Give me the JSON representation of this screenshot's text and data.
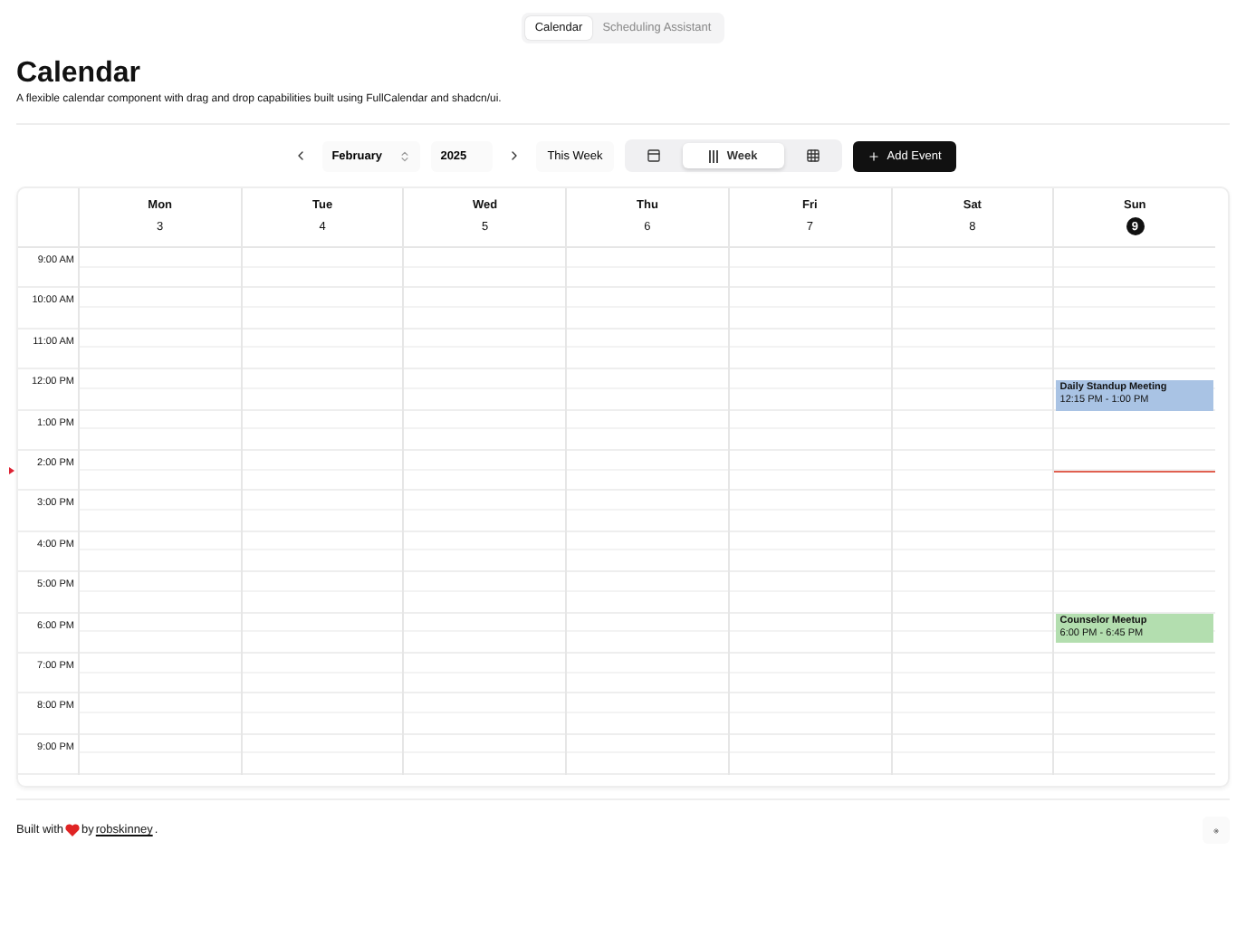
{
  "top_tabs": [
    {
      "label": "Calendar",
      "selected": true
    },
    {
      "label": "Scheduling Assistant",
      "selected": false
    }
  ],
  "title": "Calendar",
  "description": "A flexible calendar component with drag and drop capabilities built using FullCalendar and shadcn/ui.",
  "toolbar": {
    "month": "February",
    "year": "2025",
    "today_button": "This Week",
    "add_button": "Add Event",
    "views": [
      {
        "kind": "day",
        "selected": false
      },
      {
        "kind": "week",
        "label": "Week",
        "selected": true
      },
      {
        "kind": "month",
        "selected": false
      }
    ]
  },
  "days": [
    {
      "name": "Mon",
      "date": "3",
      "today": false
    },
    {
      "name": "Tue",
      "date": "4",
      "today": false
    },
    {
      "name": "Wed",
      "date": "5",
      "today": false
    },
    {
      "name": "Thu",
      "date": "6",
      "today": false
    },
    {
      "name": "Fri",
      "date": "7",
      "today": false
    },
    {
      "name": "Sat",
      "date": "8",
      "today": false
    },
    {
      "name": "Sun",
      "date": "9",
      "today": true,
      "events": [
        {
          "title": "Daily Standup Meeting",
          "time": "12:15 PM - 1:00 PM",
          "color": "#a9c3e4"
        },
        {
          "title": "Counselor Meetup",
          "time": "6:00 PM - 6:45 PM",
          "color": "#b3deaf"
        }
      ]
    }
  ],
  "hours": [
    {
      "label": "9:00 AM",
      "now": false
    },
    {
      "label": "10:00 AM",
      "now": false
    },
    {
      "label": "11:00 AM",
      "now": false
    },
    {
      "label": "12:00 PM",
      "now": false
    },
    {
      "label": "1:00 PM",
      "now": false
    },
    {
      "label": "2:00 PM",
      "now": true
    },
    {
      "label": "3:00 PM",
      "now": false
    },
    {
      "label": "4:00 PM",
      "now": false
    },
    {
      "label": "5:00 PM",
      "now": false
    },
    {
      "label": "6:00 PM",
      "now": false
    },
    {
      "label": "7:00 PM",
      "now": false
    },
    {
      "label": "8:00 PM",
      "now": false
    },
    {
      "label": "9:00 PM",
      "now": false
    }
  ],
  "footer": {
    "before": "Built with",
    "after": "by",
    "link": "robskinney",
    "end": "."
  }
}
